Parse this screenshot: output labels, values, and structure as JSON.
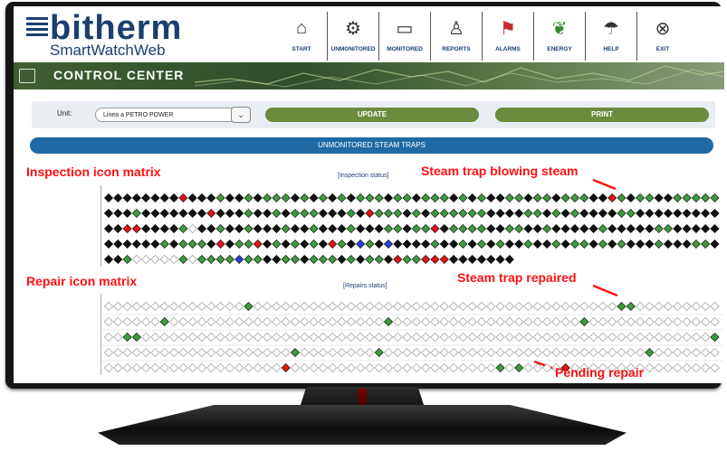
{
  "app": {
    "logo_title": "bitherm",
    "logo_subtitle": "SmartWatchWeb"
  },
  "nav": [
    {
      "label": "START",
      "icon": "home-icon"
    },
    {
      "label": "UNMONITORED",
      "icon": "steam-trap-icon"
    },
    {
      "label": "MONITORED",
      "icon": "monitor-screen-icon"
    },
    {
      "label": "REPORTS",
      "icon": "report-icon"
    },
    {
      "label": "ALARMS",
      "icon": "alarm-icon"
    },
    {
      "label": "ENERGY",
      "icon": "energy-icon"
    },
    {
      "label": "HELP",
      "icon": "help-icon"
    },
    {
      "label": "EXIT",
      "icon": "exit-icon"
    }
  ],
  "control_center": {
    "title": "CONTROL CENTER"
  },
  "unit_panel": {
    "label": "Unit:",
    "selected": "Linea a PETRO POWER",
    "update": "UPDATE",
    "print": "PRINT"
  },
  "section_title": "UNMONITORED STEAM TRAPS",
  "inspection": {
    "heading": "Inspection icon matrix",
    "status_label": "[Inspection status]",
    "callout": "Steam trap blowing steam",
    "rows": [
      "KKKKKKKKRKKKGKKGKGGGKGKGKGKGGGKGGKGGGKGKGKKGGKGGKGGGKKRGKGGKKGGGGG",
      "KKKGKKKKKKKRKKKGKKGKGGGKKKGKRGGGKGKGGGGGGKKKKGGKGKGKKKKGGKKKKKKKKK",
      "KKRRKKKKGWKKGKKGKKKGKKGKKKGKKKGGKGGRKGGGGKKGGKKGKKKKKGKKKKKGGKKKKK",
      "KKKKKKGKGGGKRKGGRKGKGKGKRGKBGKBKKKKGKKGKGKGKKGKKGKGGKGKGKKKGKKKGGK",
      "KKGWWWWWGWGGGGBGGKKGGKGGGKGKGGKRGGRRRKKKKKKK"
    ]
  },
  "repair": {
    "heading": "Repair icon matrix",
    "status_label": "[Repairs status]",
    "callout_repaired": "Steam trap repaired",
    "callout_pending": "Pending repair",
    "rows": [
      "OOOOOOOOOOOOOOOGOOOOOOOOOOOOOOOOOOOOOOOOOOOOOOOOOOOOOOOGGOOOOOOOOO",
      "OOOOOOGOOOOOOOOOOOOOOOOOOOOOOOGOOOOOOOOOOOOOOOOOOOOGOOOOOOOOOOOOOO",
      "OOGGOOOOOOOOOOOOOOOOOOOOOOOOOOOOOOOOOOOOOOOOOOOOOOOOOOOOOOOOOOOOOG",
      "OOOOOOOOOOOOOOOOOOOOGOOOOOOOOGOOOOOOOOOOOOOOOOOOOOOOOOOOOOGOOOOOOO",
      "OOOOOOOOOOOOOOOOOOOROOOOOOOOOOOOOOOOOOOOOOGOGOOOOROOOOOOOOOOOOOOOO"
    ]
  },
  "colors": {
    "black": "#111111",
    "green": "#3f9a3f",
    "red": "#e01414",
    "blue": "#2a3fd6",
    "white": "#ffffff",
    "outline": "#8a8a8a",
    "brand": "#1b3f6e",
    "accent": "#6d8b3d"
  }
}
